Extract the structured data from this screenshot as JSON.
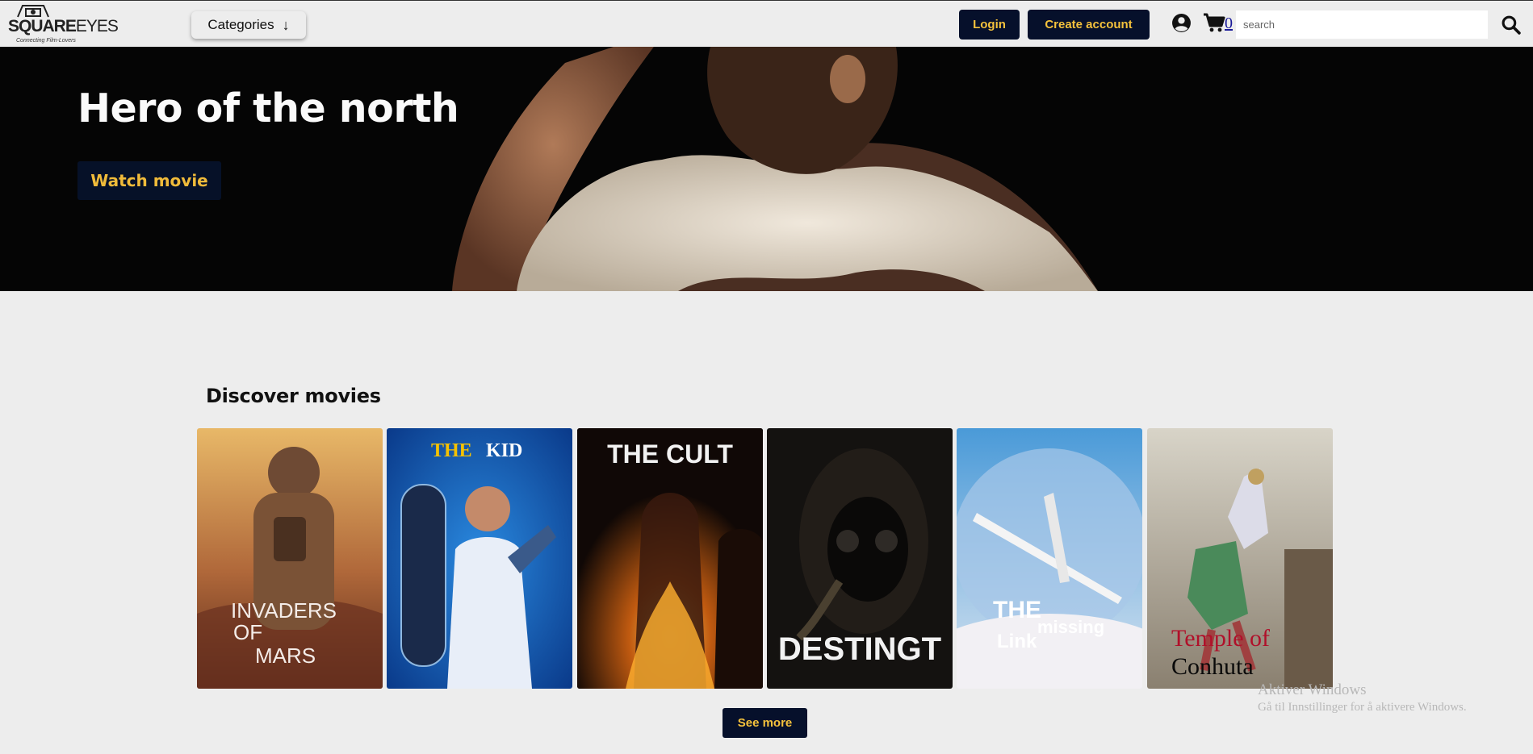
{
  "header": {
    "logo_text_bold": "SQUARE",
    "logo_text_light": "EYES",
    "logo_tagline": "Connecting Film-Lovers",
    "categories_label": "Categories",
    "categories_arrow": "↓",
    "login_label": "Login",
    "create_account_label": "Create account",
    "cart_count": "0",
    "search_placeholder": "search"
  },
  "hero": {
    "title": "Hero of the north",
    "watch_label": "Watch movie"
  },
  "discover": {
    "title": "Discover movies",
    "movies": [
      {
        "title_lines": [
          "INVADERS",
          "OF",
          "MARS"
        ]
      },
      {
        "title_a": "THE",
        "title_b": "KID"
      },
      {
        "title": "THE CULT"
      },
      {
        "title": "DESTINGT"
      },
      {
        "title_a": "THE",
        "title_b": "missing",
        "title_c": "Link"
      },
      {
        "title_a": "Temple of",
        "title_b": "Conhuta"
      }
    ],
    "see_more_label": "See more"
  },
  "watermark": {
    "line1": "Aktiver Windows",
    "line2": "Gå til Innstillinger for å aktivere Windows."
  },
  "colors": {
    "navy": "#06102b",
    "gold": "#f5c23c",
    "background": "#ededed"
  },
  "icons": {
    "user": "user-circle-icon",
    "cart": "shopping-cart-icon",
    "search": "magnifier-icon",
    "categories": "arrow-down-icon"
  }
}
